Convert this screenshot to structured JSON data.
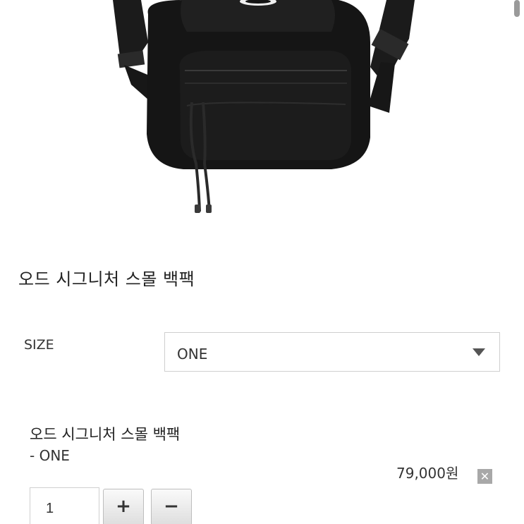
{
  "product": {
    "title": "오드 시그니처 스몰 백팩",
    "image_alt": "black backpack"
  },
  "size": {
    "label": "SIZE",
    "selected": "ONE"
  },
  "selected_item": {
    "name": "오드 시그니처 스몰 백팩",
    "option": "- ONE",
    "price": "79,000원",
    "quantity": "1"
  },
  "icons": {
    "dropdown": "triangle-down-icon",
    "remove": "close-icon",
    "increase": "plus-icon",
    "decrease": "minus-icon"
  }
}
